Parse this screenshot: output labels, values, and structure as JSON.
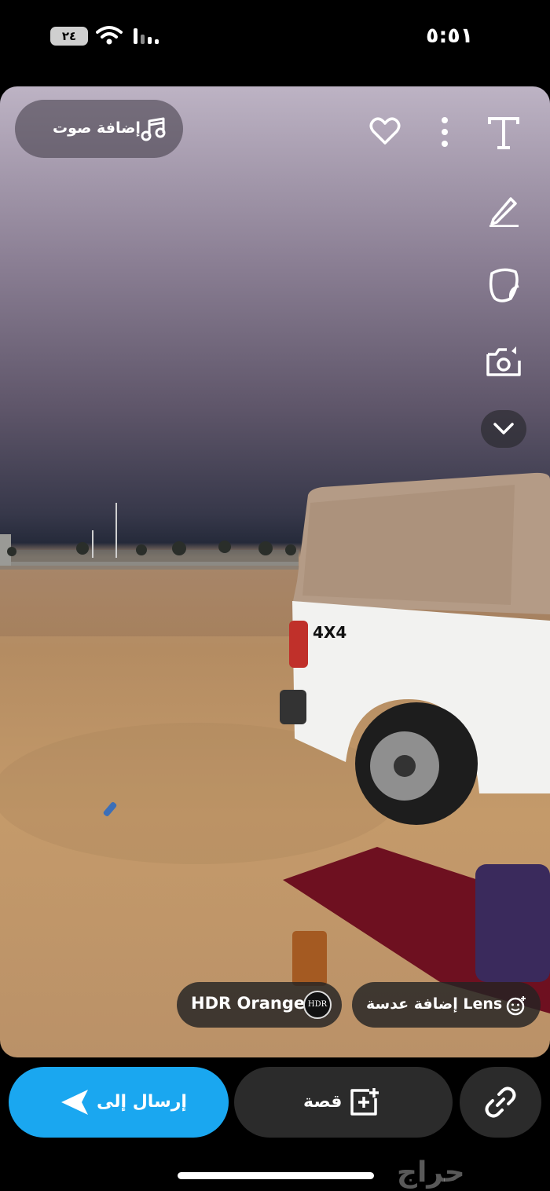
{
  "status": {
    "time": "٥:٥١",
    "battery": "٢٤"
  },
  "top": {
    "sound_label": "إضافة صوت"
  },
  "lenses": {
    "add_lens": "إضافة عدسة Lens",
    "active_lens": "HDR Orange",
    "active_lens_logo": "HDR"
  },
  "bottom": {
    "send_label": "إرسال إلى",
    "story_label": "قصة"
  },
  "watermark": "حراج",
  "icons": [
    "music-icon",
    "heart-icon",
    "more-icon",
    "text-tool-icon",
    "pen-icon",
    "sticker-icon",
    "camera-flip-icon",
    "chevron-down-icon",
    "lens-smile-icon",
    "send-arrow-icon",
    "add-story-icon",
    "link-icon"
  ],
  "colors": {
    "send_button": "#1aa7f0",
    "dark_button": "#2b2b2b"
  }
}
